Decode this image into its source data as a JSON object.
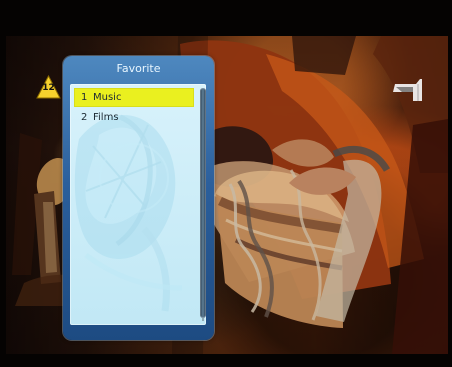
{
  "overlay": {
    "rating_badge": "12",
    "channel_logo": "channel-logo",
    "channel_logo_shape": "4"
  },
  "favorite_menu": {
    "title": "Favorite",
    "items": [
      {
        "number": "1",
        "label": "Music",
        "selected": true
      },
      {
        "number": "2",
        "label": "Films",
        "selected": false
      }
    ],
    "scrollbar": "visible"
  },
  "colors": {
    "panel_blue": "#2b5f9c",
    "list_background": "#c1e8f5",
    "selection_yellow": "#eaf01f",
    "title_text": "#e8f6ff",
    "rating_yellow": "#f6d12d",
    "channel_logo_white": "#f5f5f5"
  },
  "icons": {
    "rating": "rating-badge-icon",
    "logo": "channel-logo-icon",
    "scroll": "scrollbar-thumb-icon"
  }
}
